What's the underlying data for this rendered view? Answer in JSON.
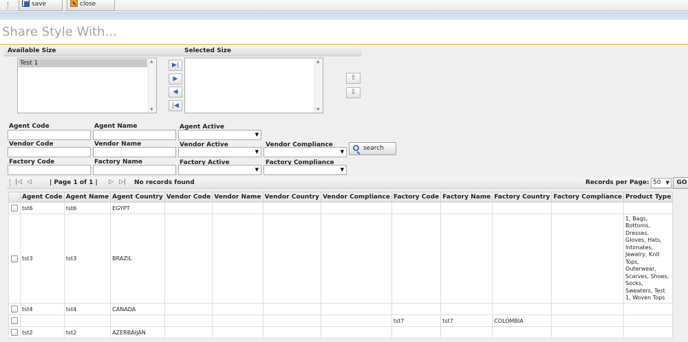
{
  "toolbar": {
    "save_label": "save",
    "close_label": "close"
  },
  "page": {
    "title": "Share Style With..."
  },
  "size_selector": {
    "available_label": "Available Size",
    "selected_label": "Selected Size",
    "available_items": [
      "Test 1"
    ],
    "selected_items": []
  },
  "filters": {
    "agent_code": "Agent Code",
    "agent_name": "Agent Name",
    "agent_active": "Agent Active",
    "vendor_code": "Vendor Code",
    "vendor_name": "Vendor Name",
    "vendor_active": "Vendor Active",
    "vendor_compliance": "Vendor Compliance",
    "factory_code": "Factory Code",
    "factory_name": "Factory Name",
    "factory_active": "Factory Active",
    "factory_compliance": "Factory Compliance",
    "search_label": "search"
  },
  "pager": {
    "page_text": "| Page 1 of 1 |",
    "status": "No records found",
    "records_label": "Records per Page:",
    "records_value": "50",
    "go_label": "GO"
  },
  "grid": {
    "columns": [
      "Agent Code",
      "Agent Name",
      "Agent Country",
      "Vendor Code",
      "Vendor Name",
      "Vendor Country",
      "Vendor Compliance",
      "Factory Code",
      "Factory Name",
      "Factory Country",
      "Factory Compliance",
      "Product Type"
    ],
    "rows": [
      [
        "tst6",
        "tst6",
        "EGYPT",
        "",
        "",
        "",
        "",
        "",
        "",
        "",
        "",
        ""
      ],
      [
        "tst3",
        "tst3",
        "BRAZIL",
        "",
        "",
        "",
        "",
        "",
        "",
        "",
        "",
        "1, Bags, Bottoms, Dresses, Gloves, Hats, Intimates, Jewelry, Knit Tops, Outerwear, Scarves, Shoes, Socks, Sweaters, Test 1, Woven Tops"
      ],
      [
        "tst4",
        "tst4",
        "CANADA",
        "",
        "",
        "",
        "",
        "",
        "",
        "",
        "",
        ""
      ],
      [
        "",
        "",
        "",
        "",
        "",
        "",
        "",
        "tst7",
        "tst7",
        "COLOMBIA",
        "",
        ""
      ],
      [
        "tst2",
        "tst2",
        "AZERBAIJAN",
        "",
        "",
        "",
        "",
        "",
        "",
        "",
        "",
        ""
      ]
    ]
  }
}
